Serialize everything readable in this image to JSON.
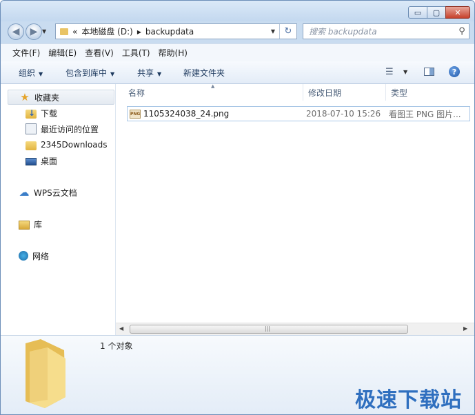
{
  "titlebar": {
    "minimize": "▭",
    "maximize": "▢",
    "close": "✕"
  },
  "nav": {
    "back": "◀",
    "forward": "▶",
    "history_dropdown": "▼",
    "crumb_overflow": "«",
    "crumbs": [
      "本地磁盘 (D:)",
      "backupdata"
    ],
    "separator": "▸",
    "address_dropdown": "▼",
    "refresh": "↻"
  },
  "search": {
    "placeholder": "搜索 backupdata",
    "icon": "⚲"
  },
  "menubar": [
    "文件(F)",
    "编辑(E)",
    "查看(V)",
    "工具(T)",
    "帮助(H)"
  ],
  "commands": {
    "organize": "组织",
    "include_library": "包含到库中",
    "share": "共享",
    "new_folder": "新建文件夹",
    "caret": "▼",
    "view_icon": "☰",
    "help": "?"
  },
  "sidebar": {
    "favorites": "收藏夹",
    "items": [
      "下载",
      "最近访问的位置",
      "2345Downloads",
      "桌面"
    ],
    "wps": "WPS云文档",
    "library": "库",
    "network": "网络"
  },
  "columns": {
    "name": "名称",
    "date": "修改日期",
    "type": "类型",
    "sort_arrow": "▲"
  },
  "files": [
    {
      "icon_label": "PNG",
      "name": "1105324038_24.png",
      "date": "2018-07-10 15:26",
      "type": "看图王 PNG 图片..."
    }
  ],
  "scrollbar": {
    "left": "◀",
    "right": "▶",
    "grip": "|||"
  },
  "details": {
    "count": "1 个对象"
  },
  "watermark": "极速下载站",
  "colors": {
    "accent": "#2f6fbf",
    "folder": "#e2b441",
    "selection_border": "#a8c6e6"
  }
}
